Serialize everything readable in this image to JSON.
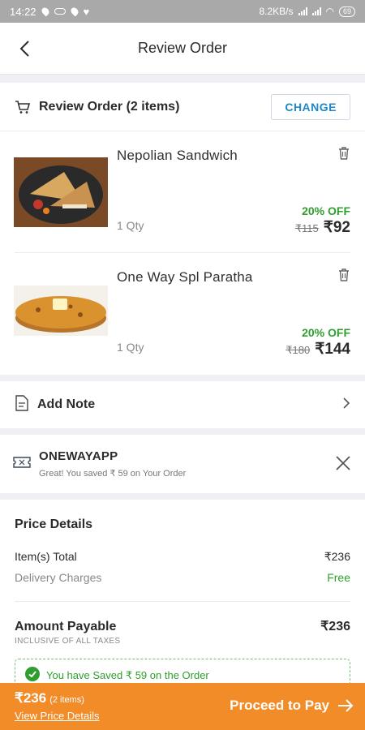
{
  "status": {
    "time": "14:22",
    "speed": "8.2KB/s",
    "battery": "69"
  },
  "header": {
    "title": "Review Order"
  },
  "review": {
    "label": "Review Order (2 items)",
    "change_label": "CHANGE"
  },
  "items": [
    {
      "name": "Nepolian Sandwich",
      "qty": "1 Qty",
      "discount": "20% OFF",
      "mrp": "₹115",
      "price": "₹92"
    },
    {
      "name": "One Way Spl Paratha",
      "qty": "1 Qty",
      "discount": "20% OFF",
      "mrp": "₹180",
      "price": "₹144"
    }
  ],
  "note": {
    "label": "Add Note"
  },
  "coupon": {
    "code": "ONEWAYAPP",
    "message": "Great! You saved ₹ 59 on Your Order"
  },
  "price_details": {
    "title": "Price Details",
    "items_total_label": "Item(s) Total",
    "items_total_value": "₹236",
    "delivery_label": "Delivery Charges",
    "delivery_value": "Free",
    "amount_label": "Amount Payable",
    "amount_value": "₹236",
    "amount_note": "INCLUSIVE OF ALL TAXES",
    "saved_message": "You have Saved ₹ 59 on the Order"
  },
  "footer": {
    "total": "₹236",
    "count": "(2 items)",
    "details_link": "View Price Details",
    "proceed_label": "Proceed to Pay"
  },
  "colors": {
    "accent": "#f28c28",
    "success": "#2e9e2e",
    "link": "#1e88c8"
  }
}
